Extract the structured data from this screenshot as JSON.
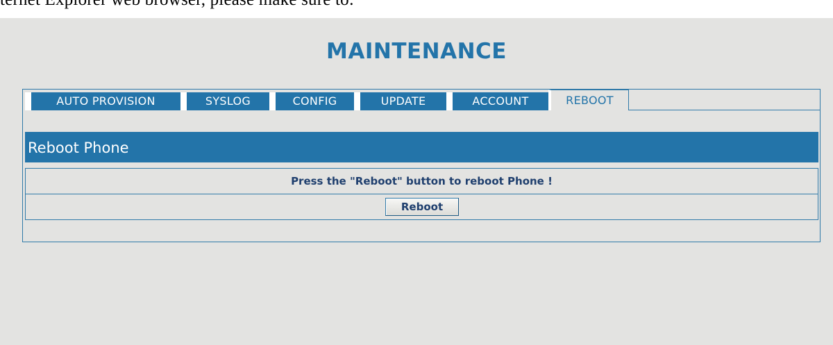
{
  "top_text": "ternet Explorer web browser, please make sure to:",
  "page_title": "MAINTENANCE",
  "tabs": [
    {
      "label": "AUTO PROVISION",
      "active": false
    },
    {
      "label": "SYSLOG",
      "active": false
    },
    {
      "label": "CONFIG",
      "active": false
    },
    {
      "label": "UPDATE",
      "active": false
    },
    {
      "label": "ACCOUNT",
      "active": false
    },
    {
      "label": "REBOOT",
      "active": true
    }
  ],
  "section": {
    "title": "Reboot Phone",
    "message": "Press the \"Reboot\" button to reboot Phone !",
    "button_label": "Reboot"
  },
  "colors": {
    "accent": "#2374a9",
    "background": "#e3e3e1",
    "text_dark": "#1f3f6e"
  }
}
